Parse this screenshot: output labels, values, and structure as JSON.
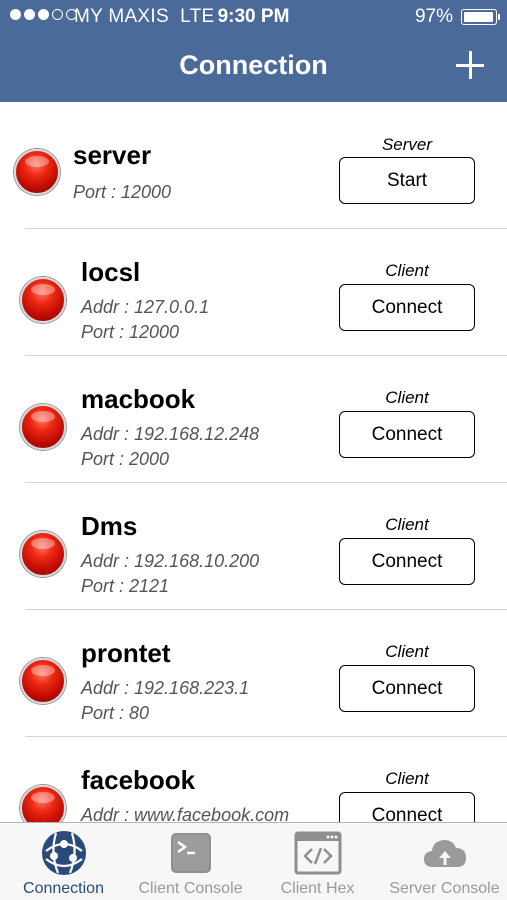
{
  "status_bar": {
    "carrier": "MY MAXIS",
    "network": "LTE",
    "time": "9:30 PM",
    "battery": "97%",
    "battery_level": 0.97,
    "signal_bars_filled": 3,
    "signal_bars_total": 5
  },
  "nav": {
    "title": "Connection",
    "add_icon": "plus-icon"
  },
  "connections": [
    {
      "name": "server",
      "type": "Server",
      "addr": "",
      "port": "Port : 12000",
      "button": "Start",
      "status_color": "#e02010"
    },
    {
      "name": "locsl",
      "type": "Client",
      "addr": "Addr : 127.0.0.1",
      "port": "Port : 12000",
      "button": "Connect",
      "status_color": "#e02010"
    },
    {
      "name": "macbook",
      "type": "Client",
      "addr": "Addr : 192.168.12.248",
      "port": "Port : 2000",
      "button": "Connect",
      "status_color": "#e02010"
    },
    {
      "name": "Dms",
      "type": "Client",
      "addr": "Addr : 192.168.10.200",
      "port": "Port : 2121",
      "button": "Connect",
      "status_color": "#e02010"
    },
    {
      "name": "prontet",
      "type": "Client",
      "addr": "Addr : 192.168.223.1",
      "port": "Port : 80",
      "button": "Connect",
      "status_color": "#e02010"
    },
    {
      "name": "facebook",
      "type": "Client",
      "addr": "Addr : www.facebook.com",
      "port": "",
      "button": "Connect",
      "status_color": "#e02010"
    }
  ],
  "tabs": [
    {
      "label": "Connection",
      "icon": "globe-network-icon",
      "active": true
    },
    {
      "label": "Client Console",
      "icon": "terminal-icon",
      "active": false
    },
    {
      "label": "Client Hex",
      "icon": "code-window-icon",
      "active": false
    },
    {
      "label": "Server Console",
      "icon": "cloud-upload-icon",
      "active": false
    }
  ],
  "colors": {
    "header": "#4a6a9a",
    "tab_active": "#2a4a7a",
    "tab_inactive": "#9a9a9a",
    "status_led": "#e02010"
  }
}
